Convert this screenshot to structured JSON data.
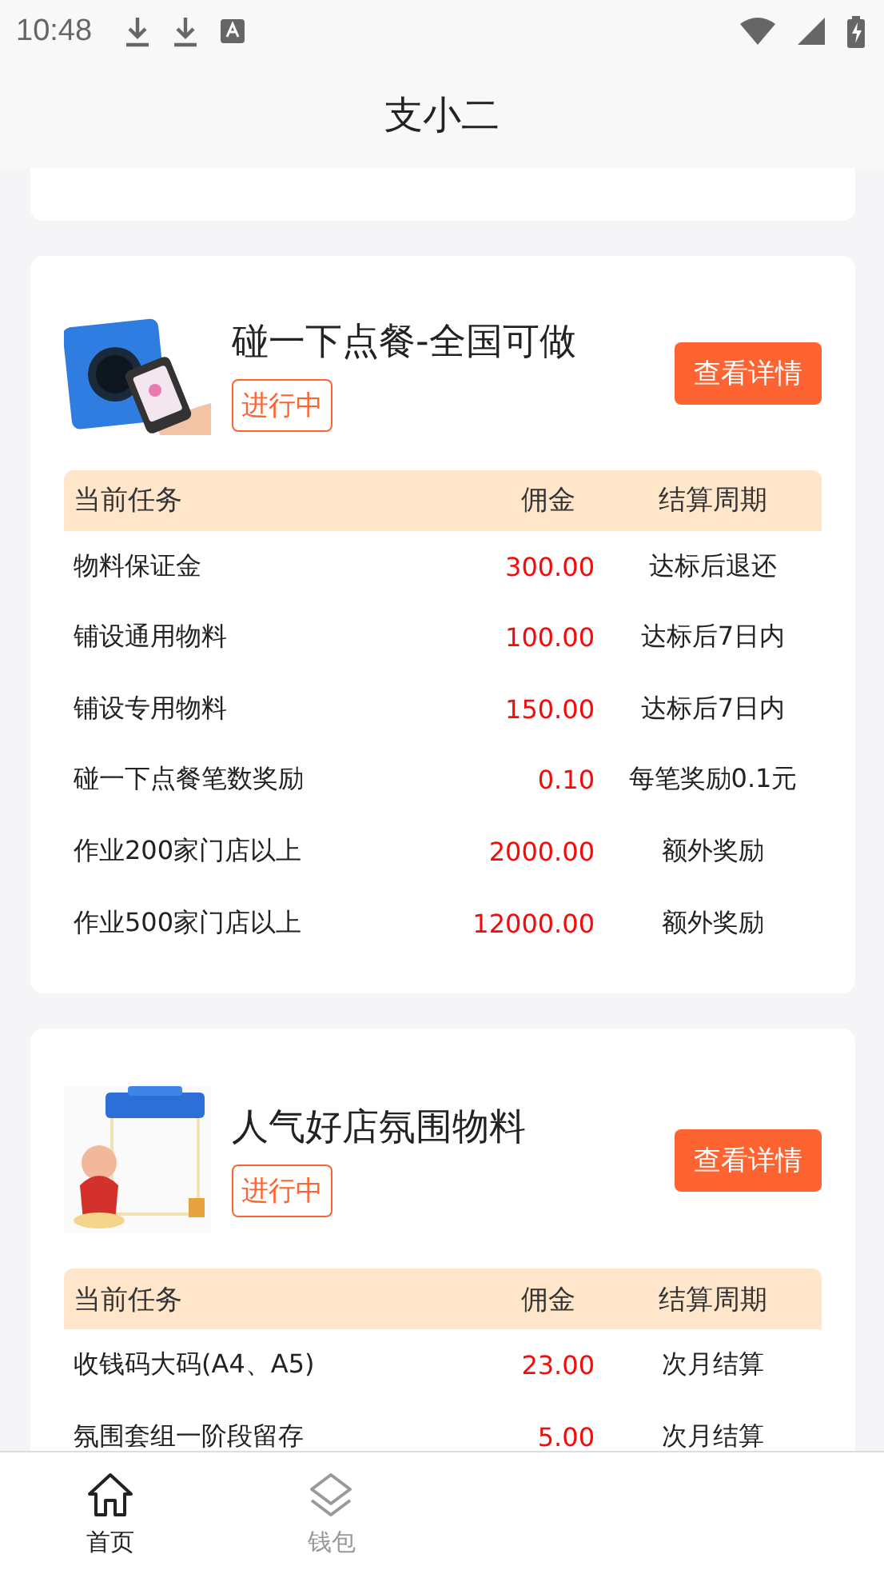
{
  "status_bar": {
    "time": "10:48"
  },
  "header": {
    "title": "支小二"
  },
  "tasks": [
    {
      "title": "碰一下点餐-全国可做",
      "status": "进行中",
      "action": "查看详情",
      "columns": [
        "当前任务",
        "佣金",
        "结算周期"
      ],
      "rows": [
        {
          "task": "物料保证金",
          "commission": "300.00",
          "period": "达标后退还"
        },
        {
          "task": "铺设通用物料",
          "commission": "100.00",
          "period": "达标后7日内"
        },
        {
          "task": "铺设专用物料",
          "commission": "150.00",
          "period": "达标后7日内"
        },
        {
          "task": "碰一下点餐笔数奖励",
          "commission": "0.10",
          "period": "每笔奖励0.1元"
        },
        {
          "task": "作业200家门店以上",
          "commission": "2000.00",
          "period": "额外奖励"
        },
        {
          "task": "作业500家门店以上",
          "commission": "12000.00",
          "period": "额外奖励"
        }
      ]
    },
    {
      "title": "人气好店氛围物料",
      "status": "进行中",
      "action": "查看详情",
      "columns": [
        "当前任务",
        "佣金",
        "结算周期"
      ],
      "rows": [
        {
          "task": "收钱码大码(A4、A5)",
          "commission": "23.00",
          "period": "次月结算"
        },
        {
          "task": "氛围套组一阶段留存",
          "commission": "5.00",
          "period": "次月结算"
        }
      ]
    }
  ],
  "bottom_nav": [
    {
      "label": "首页",
      "kind": "home",
      "selected": true
    },
    {
      "label": "钱包",
      "kind": "layers",
      "selected": false
    }
  ]
}
